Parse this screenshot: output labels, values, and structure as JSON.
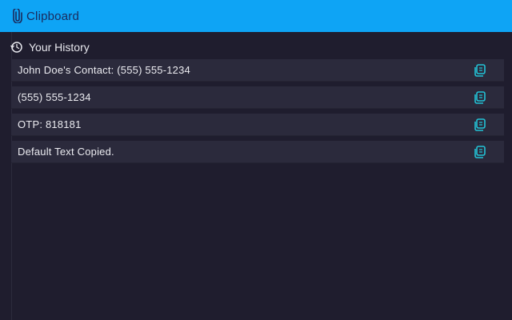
{
  "app": {
    "title": "Clipboard",
    "accent_color": "#0ea4f5",
    "icon": "paperclip-icon"
  },
  "history": {
    "heading": "Your History",
    "heading_icon": "history-icon",
    "items": [
      {
        "text": "John Doe's Contact: (555) 555-1234",
        "action_icon": "copy-icon"
      },
      {
        "text": "(555) 555-1234",
        "action_icon": "copy-icon"
      },
      {
        "text": "OTP: 818181",
        "action_icon": "copy-icon"
      },
      {
        "text": "Default Text Copied.",
        "action_icon": "copy-icon"
      }
    ]
  }
}
